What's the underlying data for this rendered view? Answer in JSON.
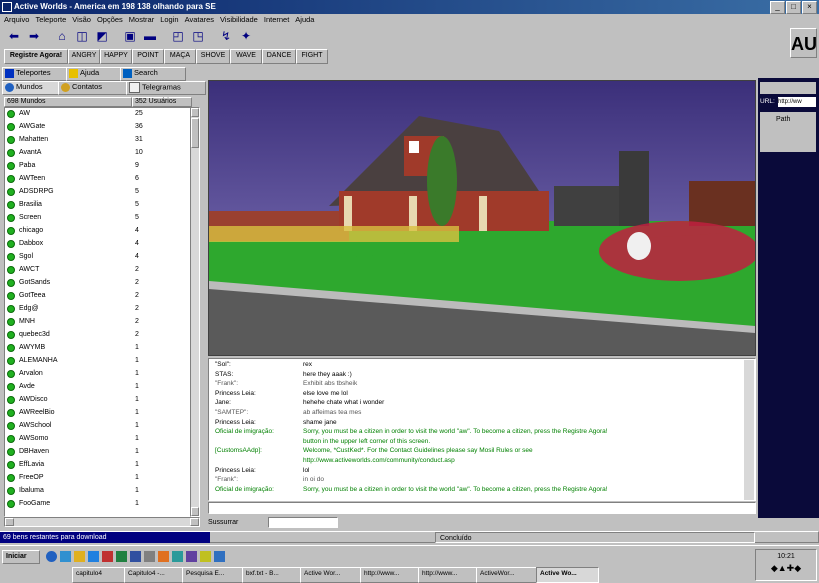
{
  "window": {
    "title": "Active Worlds - America em 198 138 olhando para SE"
  },
  "menu": [
    "Arquivo",
    "Teleporte",
    "Visão",
    "Opções",
    "Mostrar",
    "Login",
    "Avatares",
    "Visibilidade",
    "Internet",
    "Ajuda"
  ],
  "gestures": {
    "register_label": "Registre Agora!",
    "buttons": [
      "ANGRY",
      "HAPPY",
      "POINT",
      "MAÇA",
      "SHOVE",
      "WAVE",
      "DANCE",
      "FIGHT"
    ]
  },
  "logo_text": "AU",
  "tabs": {
    "row1": [
      "Teleportes",
      "Ajuda",
      "Search"
    ],
    "row2": [
      "Mundos",
      "Contatos",
      "Telegramas"
    ]
  },
  "world_list": {
    "col_worlds": "698 Mundos",
    "col_users": "352 Usuários",
    "rows": [
      {
        "name": "AW",
        "count": "25"
      },
      {
        "name": "AWGate",
        "count": "36"
      },
      {
        "name": "Mahatten",
        "count": "31"
      },
      {
        "name": "AvantA",
        "count": "10"
      },
      {
        "name": "Paba",
        "count": "9"
      },
      {
        "name": "AWTeen",
        "count": "6"
      },
      {
        "name": "ADSDRPG",
        "count": "5"
      },
      {
        "name": "Brasilia",
        "count": "5"
      },
      {
        "name": "Screen",
        "count": "5"
      },
      {
        "name": "chicago",
        "count": "4"
      },
      {
        "name": "Dabbox",
        "count": "4"
      },
      {
        "name": "Sgol",
        "count": "4"
      },
      {
        "name": "AWCT",
        "count": "2"
      },
      {
        "name": "GotSands",
        "count": "2"
      },
      {
        "name": "GotTeea",
        "count": "2"
      },
      {
        "name": "Edg@",
        "count": "2"
      },
      {
        "name": "MNH",
        "count": "2"
      },
      {
        "name": "quebec3d",
        "count": "2"
      },
      {
        "name": "AWYMB",
        "count": "1"
      },
      {
        "name": "ALEMANHA",
        "count": "1"
      },
      {
        "name": "Arvalon",
        "count": "1"
      },
      {
        "name": "Avde",
        "count": "1"
      },
      {
        "name": "AWDisco",
        "count": "1"
      },
      {
        "name": "AWReelBio",
        "count": "1"
      },
      {
        "name": "AWSchool",
        "count": "1"
      },
      {
        "name": "AWSomo",
        "count": "1"
      },
      {
        "name": "DBHaven",
        "count": "1"
      },
      {
        "name": "EffLavia",
        "count": "1"
      },
      {
        "name": "FreeOP",
        "count": "1"
      },
      {
        "name": "Ibaluma",
        "count": "1"
      },
      {
        "name": "FooGame",
        "count": "1"
      }
    ]
  },
  "chat": [
    {
      "who": "\"Sol\":",
      "msg": "rex",
      "color": "#000000"
    },
    {
      "who": "STAS:",
      "msg": "here they aaak :)",
      "color": "#000000"
    },
    {
      "who": "\"Frank\":",
      "msg": "Exhibit abs tbsheik",
      "color": "#555555"
    },
    {
      "who": "Princess Leia:",
      "msg": "    else love me  lol",
      "color": "#000000"
    },
    {
      "who": "Jane:",
      "msg": "hehehe  chate what i wonder",
      "color": "#000000"
    },
    {
      "who": "\"SAMTEP\":",
      "msg": "ab affeimas tea mes",
      "color": "#555555"
    },
    {
      "who": "Princess Leia:",
      "msg": "  shame    jane",
      "color": "#000000"
    },
    {
      "who": "Oficial de imigração:",
      "msg": "Sorry, you must be a citizen in order to visit the world \"aw\".  To become a citizen, press the Registre Agora!",
      "color": "#008000"
    },
    {
      "who": "",
      "msg": "button in the upper left corner of this screen.",
      "color": "#008000"
    },
    {
      "who": "[CustomsAAdp]:",
      "msg": "Welcome, *CustKed*.  For the Contact Guidelines please say Mosil Rules or see",
      "color": "#008000"
    },
    {
      "who": "",
      "msg": "http://www.activeworlds.com/community/conduct.asp",
      "color": "#008000"
    },
    {
      "who": "Princess Leia:",
      "msg": "lol",
      "color": "#000000"
    },
    {
      "who": "\"Frank\":",
      "msg": "in oi do",
      "color": "#555555"
    },
    {
      "who": "Oficial de imigração:",
      "msg": "Sorry, you must be a citizen in order to visit the world \"aw\".  To become a citizen, press the Registre Agora!",
      "color": "#008000"
    }
  ],
  "whisper_label": "Sussurrar",
  "status": {
    "left": "69 bens restantes para download",
    "right": "Concluído"
  },
  "taskbar": {
    "start_label": "Iniciar",
    "tasks": [
      "capitulo4",
      "Capitulo4 -...",
      "Pesquisa E...",
      "bxf.txt - B...",
      "Active Wor...",
      "http://www...",
      "http://www...",
      "ActiveWor...",
      "Active Wo..."
    ],
    "clock": "10:21"
  },
  "right_panel": {
    "url_label": "URL:",
    "url_value": "http://ww",
    "path_label": "Path"
  },
  "colors": {
    "title": "#0a246a",
    "sky": "#5a4a9a",
    "lawn": "#2ea82e",
    "road": "#5a5a5a",
    "online": "#20b020"
  }
}
